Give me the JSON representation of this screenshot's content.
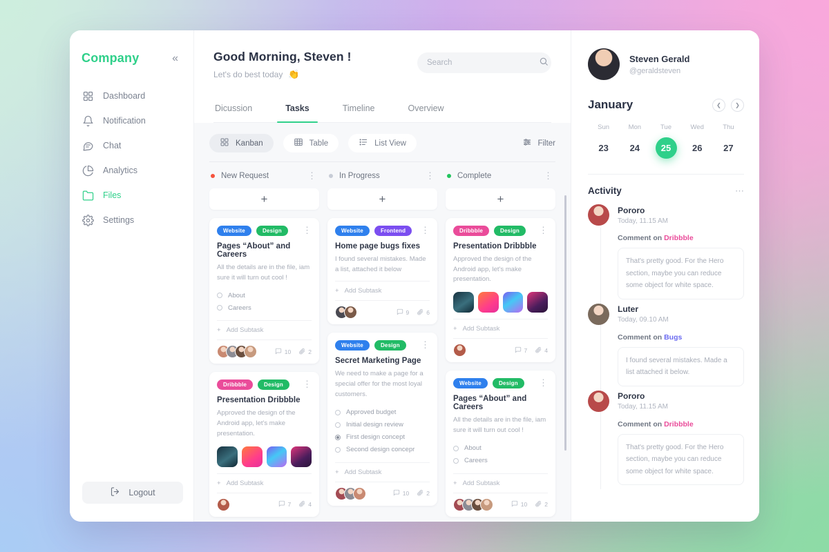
{
  "sidebar": {
    "brand": "Company",
    "collapse_icon": "chevron-double-left-icon",
    "items": [
      {
        "label": "Dashboard",
        "icon": "grid-icon",
        "active": false
      },
      {
        "label": "Notification",
        "icon": "bell-icon",
        "active": false
      },
      {
        "label": "Chat",
        "icon": "chat-bubble-icon",
        "active": false
      },
      {
        "label": "Analytics",
        "icon": "pie-chart-icon",
        "active": false
      },
      {
        "label": "Files",
        "icon": "folder-icon",
        "active": true
      },
      {
        "label": "Settings",
        "icon": "gear-icon",
        "active": false
      }
    ],
    "logout_label": "Logout",
    "logout_icon": "logout-icon"
  },
  "header": {
    "greeting": "Good Morning, Steven !",
    "subtitle": "Let's do best today",
    "subtitle_emoji": "👏",
    "search_placeholder": "Search",
    "search_value": "",
    "search_icon": "search-icon"
  },
  "tabs": [
    {
      "label": "Dicussion",
      "active": false
    },
    {
      "label": "Tasks",
      "active": true
    },
    {
      "label": "Timeline",
      "active": false
    },
    {
      "label": "Overview",
      "active": false
    }
  ],
  "toolbar": {
    "views": [
      {
        "label": "Kanban",
        "icon": "grid-icon",
        "active": true
      },
      {
        "label": "Table",
        "icon": "table-icon",
        "active": false
      },
      {
        "label": "List View",
        "icon": "list-icon",
        "active": false
      }
    ],
    "filter_label": "Filter",
    "filter_icon": "sliders-icon"
  },
  "board": {
    "add_card_label": "+",
    "add_subtask_label": "Add Subtask",
    "columns": [
      {
        "title": "New Request",
        "dot_color": "#f5533d",
        "cards": [
          {
            "tags": [
              {
                "label": "Website",
                "color": "#2f80ed"
              },
              {
                "label": "Design",
                "color": "#22bb66"
              }
            ],
            "title": "Pages “About” and Careers",
            "desc": "All the details are in the file, iam sure it will turn out cool !",
            "subtasks": [
              {
                "label": "About",
                "done": false
              },
              {
                "label": "Careers",
                "done": false
              }
            ],
            "thumbs": [],
            "avatars": [
              "#c98a72",
              "#8c8c94",
              "#6b4f3f",
              "#c79a7e"
            ],
            "comments": "10",
            "attachments": "2"
          },
          {
            "tags": [
              {
                "label": "Dribbble",
                "color": "#ea4c9a"
              },
              {
                "label": "Design",
                "color": "#22bb66"
              }
            ],
            "title": "Presentation Dribbble",
            "desc": "Approved the design of the Android app, let's make presentation.",
            "subtasks": [],
            "thumbs": [
              "#1b3a4b",
              "#ff5f6d",
              "#8e44ef",
              "#3b1a4a"
            ],
            "avatars": [
              "#b35b49"
            ],
            "comments": "7",
            "attachments": "4"
          }
        ]
      },
      {
        "title": "In Progress",
        "dot_color": "#c7ccd6",
        "cards": [
          {
            "tags": [
              {
                "label": "Website",
                "color": "#2f80ed"
              },
              {
                "label": "Frontend",
                "color": "#7b4ef0"
              }
            ],
            "title": "Home page bugs fixes",
            "desc": "I found several mistakes. Made a list, attached it below",
            "subtasks": [],
            "thumbs": [],
            "avatars": [
              "#4a4a52",
              "#7a5a48"
            ],
            "comments": "9",
            "attachments": "6"
          },
          {
            "tags": [
              {
                "label": "Website",
                "color": "#2f80ed"
              },
              {
                "label": "Design",
                "color": "#22bb66"
              }
            ],
            "title": "Secret Marketing Page",
            "desc": "We need to make a page for a special offer for the most loyal customers.",
            "subtasks": [
              {
                "label": "Approved budget",
                "done": false
              },
              {
                "label": "Initial design review",
                "done": false
              },
              {
                "label": "First design concept",
                "done": true
              },
              {
                "label": "Second design concepr",
                "done": false
              }
            ],
            "thumbs": [],
            "avatars": [
              "#a34b53",
              "#8c8c94",
              "#c98a72"
            ],
            "comments": "10",
            "attachments": "2"
          }
        ]
      },
      {
        "title": "Complete",
        "dot_color": "#22c55e",
        "cards": [
          {
            "tags": [
              {
                "label": "Dribbble",
                "color": "#ea4c9a"
              },
              {
                "label": "Design",
                "color": "#22bb66"
              }
            ],
            "title": "Presentation Dribbble",
            "desc": "Approved the design of the Android app, let's make presentation.",
            "subtasks": [],
            "thumbs": [
              "#1b3a4b",
              "#ff5f6d",
              "#8e44ef",
              "#3b1a4a"
            ],
            "avatars": [
              "#b35b49"
            ],
            "comments": "7",
            "attachments": "4"
          },
          {
            "tags": [
              {
                "label": "Website",
                "color": "#2f80ed"
              },
              {
                "label": "Design",
                "color": "#22bb66"
              }
            ],
            "title": "Pages “About” and Careers",
            "desc": "All the details are in the file, iam sure it will turn out cool !",
            "subtasks": [
              {
                "label": "About",
                "done": false
              },
              {
                "label": "Careers",
                "done": false
              }
            ],
            "thumbs": [],
            "avatars": [
              "#a34b53",
              "#8c8c94",
              "#6b4f3f",
              "#c79a7e"
            ],
            "comments": "10",
            "attachments": "2"
          }
        ]
      }
    ]
  },
  "profile": {
    "name": "Steven Gerald",
    "handle": "@geraldsteven",
    "avatar_color": "#d9a68c"
  },
  "calendar": {
    "month": "January",
    "prev_icon": "chevron-left-icon",
    "next_icon": "chevron-right-icon",
    "day_names": [
      "Sun",
      "Mon",
      "Tue",
      "Wed",
      "Thu"
    ],
    "dates": [
      {
        "num": "23",
        "selected": false
      },
      {
        "num": "24",
        "selected": false
      },
      {
        "num": "25",
        "selected": true
      },
      {
        "num": "26",
        "selected": false
      },
      {
        "num": "27",
        "selected": false
      }
    ],
    "accent": "#2fd08a"
  },
  "activity": {
    "title": "Activity",
    "menu_icon": "ellipsis-icon",
    "items": [
      {
        "name": "Pororo",
        "time": "Today, 11.15 AM",
        "prefix": "Comment on ",
        "target": "Dribbble",
        "target_color": "#ea4c9a",
        "text": "That's pretty good. For the Hero section, maybe you can reduce some object for white space.",
        "avatar_color": "#b84a4a"
      },
      {
        "name": "Luter",
        "time": "Today, 09.10 AM",
        "prefix": "Comment on ",
        "target": "Bugs",
        "target_color": "#6b6bf0",
        "text": "I found several mistakes. Made a list attached it below.",
        "avatar_color": "#7a6a5c"
      },
      {
        "name": "Pororo",
        "time": "Today, 11.15 AM",
        "prefix": "Comment on ",
        "target": "Dribbble",
        "target_color": "#ea4c9a",
        "text": "That's pretty good. For the Hero section, maybe you can reduce some object for white space.",
        "avatar_color": "#b84a4a"
      }
    ]
  }
}
